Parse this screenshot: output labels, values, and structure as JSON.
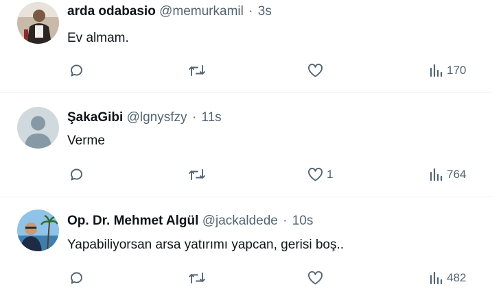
{
  "tweets": [
    {
      "name": "arda odabasio",
      "handle": "@memurkamil",
      "separator": "·",
      "time": "3s",
      "text": "Ev almam.",
      "reply_count": "",
      "retweet_count": "",
      "like_count": "",
      "view_count": "170",
      "avatar": "photo-person-dark-clothes"
    },
    {
      "name": "ŞakaGibi",
      "handle": "@lgnysfzy",
      "separator": "·",
      "time": "11s",
      "text": "Verme",
      "reply_count": "",
      "retweet_count": "",
      "like_count": "1",
      "view_count": "764",
      "avatar": "default-profile-silhouette"
    },
    {
      "name": "Op. Dr. Mehmet Algül",
      "handle": "@jackaldede",
      "separator": "·",
      "time": "10s",
      "text": "Yapabiliyorsan arsa yatırımı yapcan, gerisi boş..",
      "reply_count": "",
      "retweet_count": "",
      "like_count": "",
      "view_count": "482",
      "avatar": "photo-person-seaside"
    }
  ],
  "icons": {
    "reply": "reply-icon",
    "retweet": "retweet-icon",
    "like": "like-icon",
    "views": "views-icon"
  },
  "colors": {
    "text_primary": "#0f1419",
    "text_secondary": "#536471",
    "divider": "#eff3f4",
    "background": "#ffffff"
  }
}
